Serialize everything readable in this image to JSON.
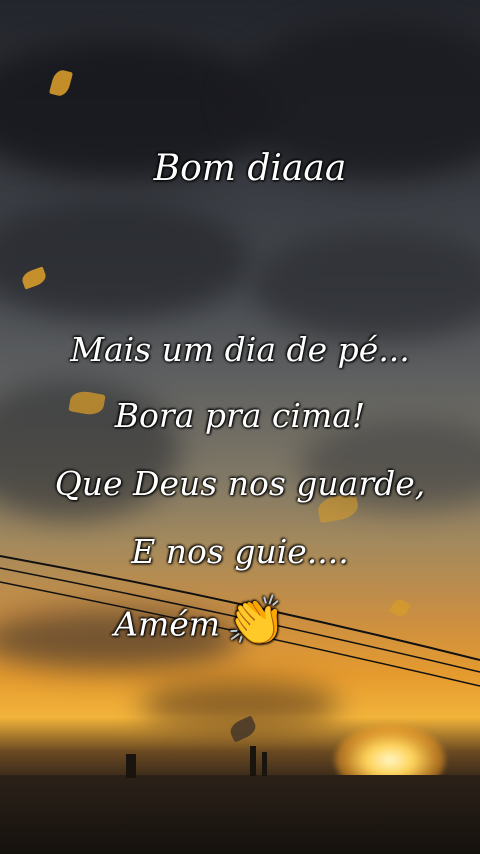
{
  "greeting": "Bom diaaa",
  "message_lines": [
    "Mais um dia de pé...",
    "Bora pra cima!",
    "Que Deus nos guarde,",
    "E nos guie....",
    "Amém"
  ],
  "clap_emoji": "👏",
  "colors": {
    "text": "#ffffff",
    "sunset_orange": "#e59a2e",
    "sky_dark": "#23252c"
  }
}
